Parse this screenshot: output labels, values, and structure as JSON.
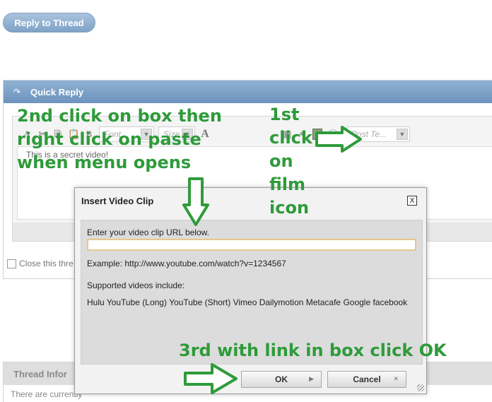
{
  "reply_button": {
    "label": "Reply to Thread"
  },
  "quick_reply": {
    "title": "Quick Reply",
    "toolbar": {
      "font_placeholder": "Font",
      "size_placeholder": "Size",
      "text_a": "A",
      "post_template_placeholder": "Post Te..."
    },
    "editor_text": "This is a secret video!"
  },
  "close_thread": {
    "label": "Close this thre"
  },
  "thread_info": {
    "title": "Thread Infor",
    "body": "There are currently"
  },
  "dialog": {
    "title": "Insert Video Clip",
    "close_label": "X",
    "prompt": "Enter your video clip URL below.",
    "url_value": "",
    "example": "Example: http://www.youtube.com/watch?v=1234567",
    "supported_heading": "Supported videos include:",
    "supported_list": "Hulu YouTube (Long) YouTube (Short) Vimeo Dailymotion Metacafe Google facebook",
    "ok_label": "OK",
    "cancel_label": "Cancel"
  },
  "annotations": {
    "second": [
      "2nd click on box then",
      "right click on paste",
      "when menu opens"
    ],
    "first": [
      "1st",
      "click",
      "on",
      "film",
      "icon"
    ],
    "third": "3rd with link in box click OK"
  },
  "colors": {
    "annotation": "#2e9b3a",
    "header_blue": "#7fa2c6",
    "input_border": "#e6c88a"
  }
}
